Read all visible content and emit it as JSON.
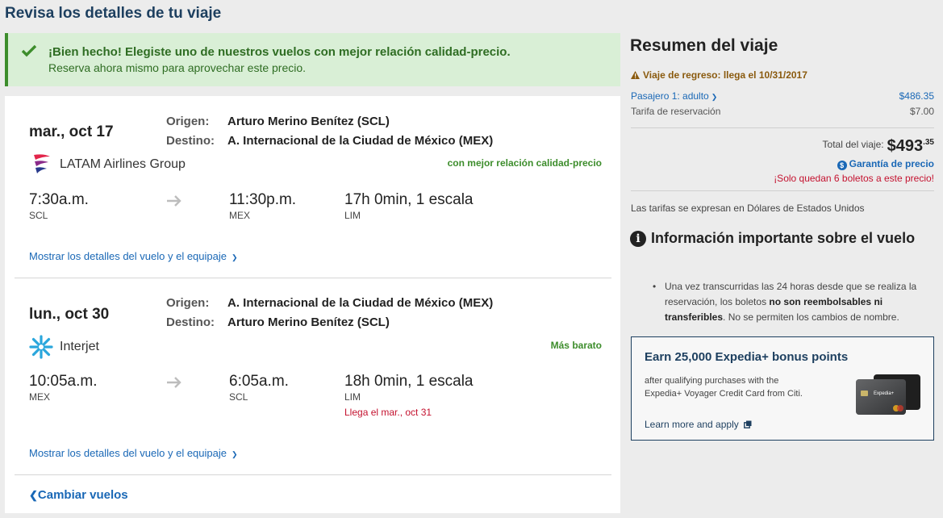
{
  "page": {
    "title": "Revisa los detalles de tu viaje"
  },
  "alert": {
    "headline": "¡Bien hecho! Elegiste uno de nuestros vuelos con mejor relación calidad-precio.",
    "subline": "Reserva ahora mismo para aprovechar este precio."
  },
  "legs": [
    {
      "date": "mar., oct 17",
      "origin_label": "Origen:",
      "origin": "Arturo Merino Benítez (SCL)",
      "dest_label": "Destino:",
      "dest": "A. Internacional de la Ciudad de México (MEX)",
      "airline": "LATAM Airlines Group",
      "tag": "con mejor relación calidad-precio",
      "depart_time": "7:30a.m.",
      "depart_code": "SCL",
      "arrive_time": "11:30p.m.",
      "arrive_code": "MEX",
      "duration": "17h 0min, 1 escala",
      "stop_code": "LIM",
      "details_link": "Mostrar los detalles del vuelo y el equipaje"
    },
    {
      "date": "lun., oct 30",
      "origin_label": "Origen:",
      "origin": "A. Internacional de la Ciudad de México (MEX)",
      "dest_label": "Destino:",
      "dest": "Arturo Merino Benítez (SCL)",
      "airline": "Interjet",
      "tag": "Más barato",
      "depart_time": "10:05a.m.",
      "depart_code": "MEX",
      "arrive_time": "6:05a.m.",
      "arrive_code": "SCL",
      "duration": "18h 0min, 1 escala",
      "stop_code": "LIM",
      "arrival_note": "Llega el mar., oct 31",
      "details_link": "Mostrar los detalles del vuelo y el equipaje"
    }
  ],
  "change_flights": "Cambiar vuelos",
  "summary": {
    "title": "Resumen del viaje",
    "warning": "Viaje de regreso: llega el 10/31/2017",
    "passenger_label": "Pasajero 1: adulto",
    "passenger_price": "$486.35",
    "fee_label": "Tarifa de reservación",
    "fee_price": "$7.00",
    "total_label": "Total del viaje:",
    "total_amount": "$493",
    "total_cents": ".35",
    "guarantee": "Garantía de precio",
    "seats_left": "¡Solo quedan 6 boletos a este precio!",
    "currency_note": "Las tarifas se expresan en Dólares de Estados Unidos"
  },
  "info": {
    "title": "Información importante sobre el vuelo",
    "bullet_pre": "Una vez transcurridas las 24 horas desde que se realiza la reservación, los boletos ",
    "bullet_bold": "no son reembolsables ni transferibles",
    "bullet_post": ". No se permiten los cambios de nombre."
  },
  "promo": {
    "title": "Earn 25,000 Expedia+ bonus points",
    "desc": "after qualifying purchases with the Expedia+ Voyager Credit Card from Citi.",
    "link": "Learn more and apply",
    "card_text": "Expedia+"
  },
  "colors": {
    "brand": "#1d3f5f",
    "link": "#1a68b6",
    "success": "#3d8d2c",
    "alert_bg": "#d9efd6",
    "error": "#c4122f"
  }
}
